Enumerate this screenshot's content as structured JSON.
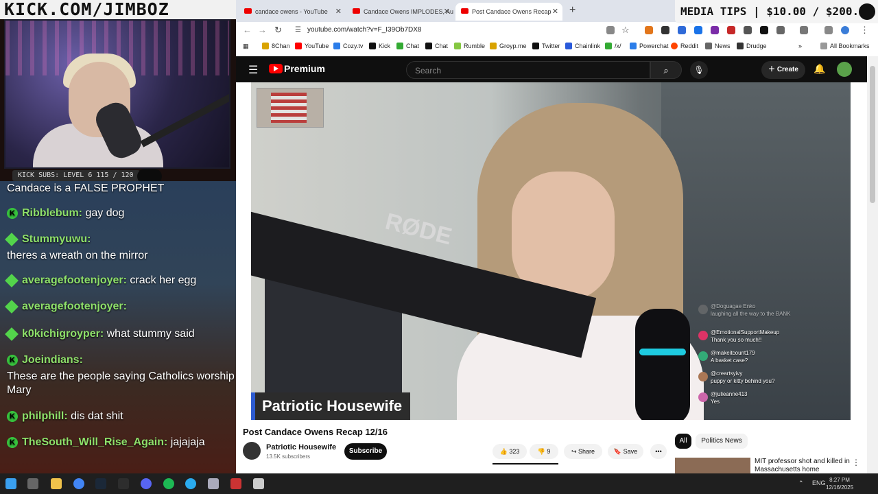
{
  "overlay": {
    "banner_text": "KICK.COM/JIMBOZ",
    "media_tips": "MEDIA TIPS | $10.00 / $200.00",
    "kick_subs": "KICK SUBS: LEVEL 6 115 / 120",
    "chat": [
      {
        "user": "",
        "text": "Candace is a FALSE PROPHET"
      },
      {
        "user": "Ribblebum:",
        "text": "gay dog"
      },
      {
        "user": "Stummyuwu:",
        "text": ""
      },
      {
        "user": "",
        "text": "theres a wreath on the mirror"
      },
      {
        "user": "averagefootenjoyer:",
        "text": "crack her egg"
      },
      {
        "user": "averagefootenjoyer:",
        "text": ""
      },
      {
        "user": "k0kichigroyper:",
        "text": "what stummy said"
      },
      {
        "user": "Joeindians:",
        "text": ""
      },
      {
        "user": "",
        "text": "These are the people saying Catholics worship"
      },
      {
        "user": "",
        "text": "Mary"
      },
      {
        "user": "philphill:",
        "text": "dis dat shit"
      },
      {
        "user": "TheSouth_Will_Rise_Again:",
        "text": "jajajaja"
      }
    ]
  },
  "browser": {
    "tabs": [
      {
        "label": "candace owens - YouTube"
      },
      {
        "label": "Candace Owens IMPLODES, Au"
      },
      {
        "label": "Post Candace Owens Recap"
      }
    ],
    "new_tab": "+",
    "url": "youtube.com/watch?v=F_I39Ob7DX8",
    "bookmarks": [
      "8Chan",
      "YouTube",
      "Cozy.tv",
      "Kick",
      "Chat",
      "Chat",
      "Rumble",
      "Groyp.me",
      "Twitter",
      "Chainlink",
      "/x/",
      "Powerchat",
      "Reddit",
      "News",
      "Drudge"
    ],
    "all_bookmarks": "All Bookmarks"
  },
  "youtube": {
    "brand": "Premium",
    "search_placeholder": "Search",
    "create_label": "Create",
    "video": {
      "rode_text": "RØDE",
      "lower_third": "Patriotic Housewife",
      "comments": [
        {
          "name": "@Doguagae Enko",
          "text": "laughing all the way to the BANK"
        },
        {
          "name": "@EmotionalSupportMakeup",
          "text": "Thank you so much!!"
        },
        {
          "name": "@makeitcount179",
          "text": "A basket case?"
        },
        {
          "name": "@creartsyivy",
          "text": "puppy or kitty behind you?"
        },
        {
          "name": "@julieanne413",
          "text": "Yes"
        }
      ]
    },
    "title": "Post Candace Owens Recap 12/16",
    "channel": {
      "name": "Patriotic Housewife",
      "subscribers": "13.5K subscribers"
    },
    "subscribe_label": "Subscribe",
    "likes": "323",
    "dislikes": "9",
    "share_label": "Share",
    "save_label": "Save",
    "chips": [
      "All",
      "Politics News"
    ],
    "recommended": {
      "title": "MIT professor shot and killed in Massachusetts home"
    }
  },
  "taskbar": {
    "language": "ENG",
    "time": "8:27 PM",
    "date": "12/16/2025"
  }
}
